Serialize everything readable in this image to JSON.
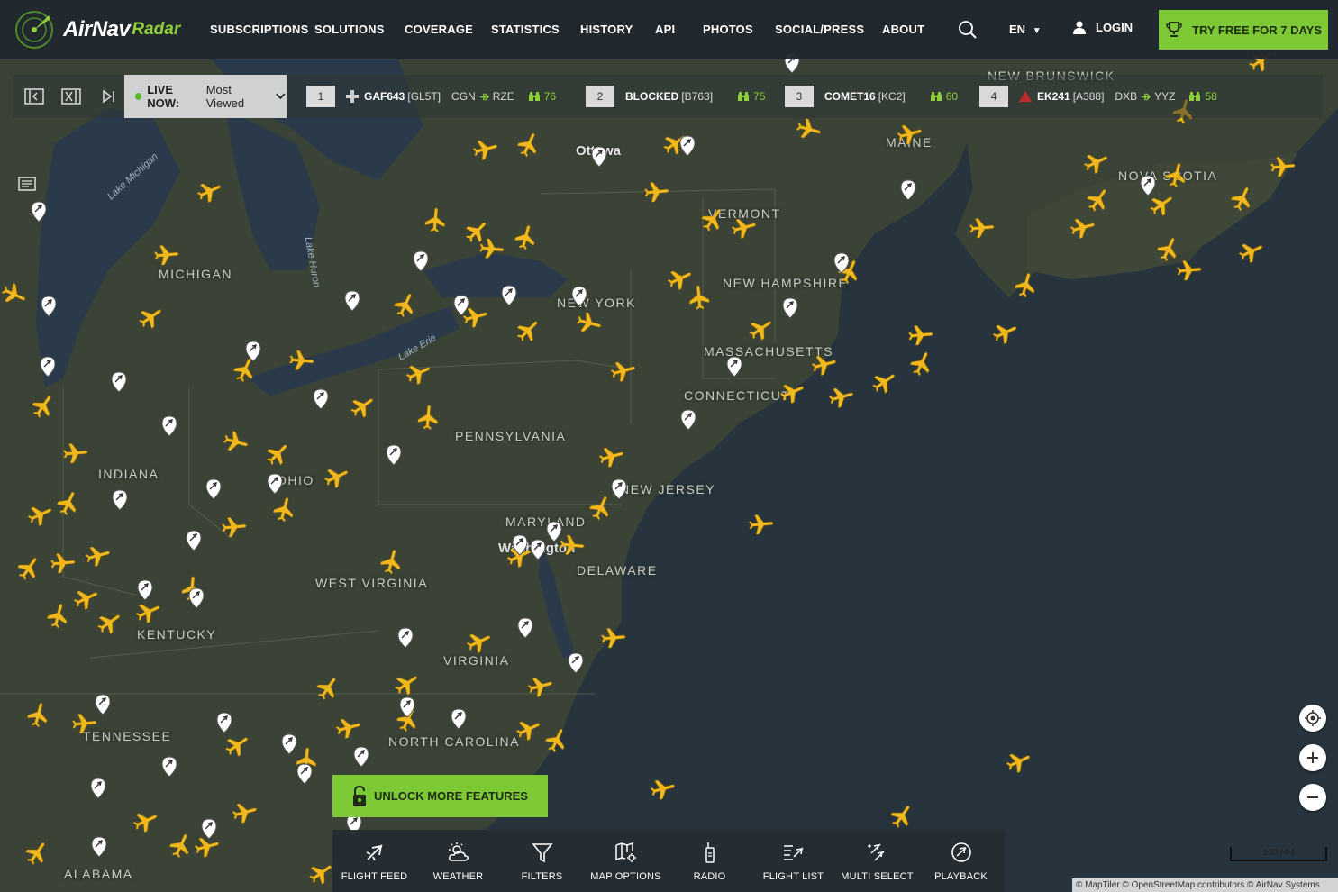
{
  "brand": {
    "name": "AirNav",
    "suffix": "Radar"
  },
  "nav": {
    "items": [
      "SUBSCRIPTIONS",
      "SOLUTIONS",
      "COVERAGE",
      "STATISTICS",
      "HISTORY",
      "API",
      "PHOTOS",
      "SOCIAL/PRESS",
      "ABOUT"
    ],
    "lang": "EN",
    "login": "LOGIN",
    "try_free": "TRY FREE FOR 7 DAYS"
  },
  "live": {
    "status": "LIVE NOW:",
    "mode": "Most Viewed",
    "flights": [
      {
        "rank": "1",
        "callsign": "GAF643",
        "type": "[GL5T]",
        "from": "CGN",
        "to": "RZE",
        "views": "76"
      },
      {
        "rank": "2",
        "callsign": "BLOCKED",
        "type": "[B763]",
        "from": "",
        "to": "",
        "views": "75"
      },
      {
        "rank": "3",
        "callsign": "COMET16",
        "type": "[KC2]",
        "from": "",
        "to": "",
        "views": "60"
      },
      {
        "rank": "4",
        "callsign": "EK241",
        "type": "[A388]",
        "from": "DXB",
        "to": "YYZ",
        "views": "58"
      }
    ]
  },
  "map": {
    "regions": [
      "MICHIGAN",
      "INDIANA",
      "OHIO",
      "PENNSYLVANIA",
      "NEW YORK",
      "VERMONT",
      "NEW HAMPSHIRE",
      "MAINE",
      "MASSACHUSETTS",
      "CONNECTICUT",
      "NEW JERSEY",
      "MARYLAND",
      "DELAWARE",
      "WEST VIRGINIA",
      "VIRGINIA",
      "KENTUCKY",
      "TENNESSEE",
      "NORTH CAROLINA",
      "ALABAMA",
      "NOVA SCOTIA",
      "NEW BRUNSWICK"
    ],
    "cities": [
      "Ottawa",
      "Washington"
    ],
    "lakes": [
      "Lake Michigan",
      "Lake Huron",
      "Lake Erie"
    ]
  },
  "unlock_label": "UNLOCK MORE FEATURES",
  "toolbar": [
    "FLIGHT FEED",
    "WEATHER",
    "FILTERS",
    "MAP OPTIONS",
    "RADIO",
    "FLIGHT LIST",
    "MULTI SELECT",
    "PLAYBACK"
  ],
  "scale_label": "100 NM",
  "attribution": "© MapTiler © OpenStreetMap contributors © AirNav Systems",
  "colors": {
    "accent": "#7dc935",
    "plane": "#f0b81c",
    "ocean": "#27343d",
    "land": "#3c4338"
  }
}
